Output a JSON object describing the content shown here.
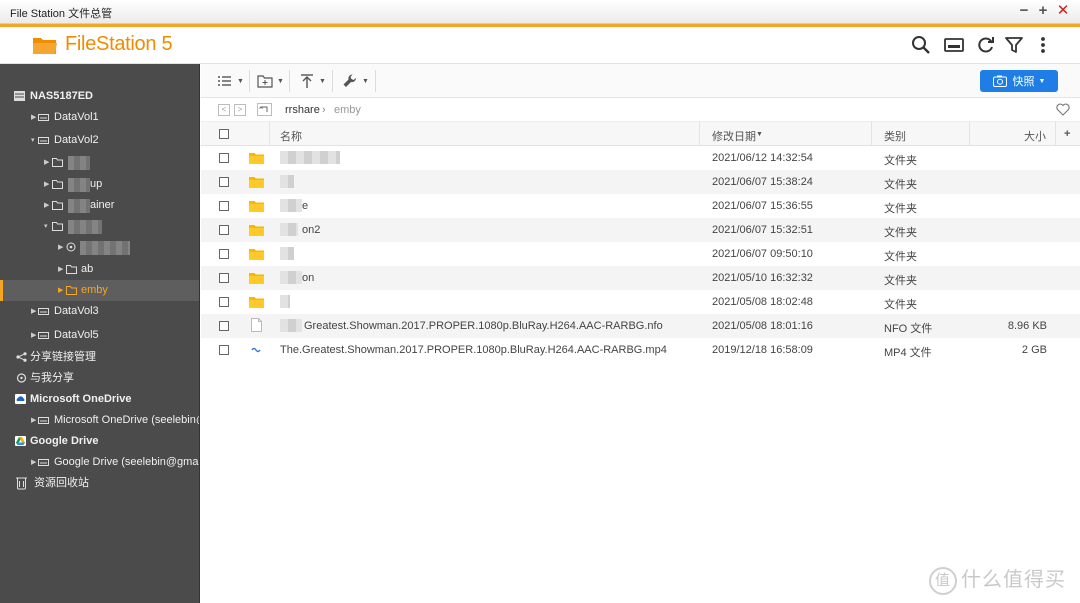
{
  "window": {
    "title": "File Station 文件总管",
    "minimize": "−",
    "maximize": "+",
    "close": "✕"
  },
  "app": {
    "name": "FileStation 5",
    "accent": "#f5a623",
    "primary": "#1e7ee6"
  },
  "header_icons": [
    "search-icon",
    "monitor-icon",
    "refresh-icon",
    "filter-icon",
    "more-vertical-icon"
  ],
  "sidebar": {
    "nas": "NAS5187ED",
    "vol1": "DataVol1",
    "vol2": "DataVol2",
    "vol2_children": [
      "",
      "up",
      "ainer",
      ""
    ],
    "ab": "ab",
    "emby": "emby",
    "vol3": "DataVol3",
    "vol5": "DataVol5",
    "share_links": "分享链接管理",
    "shared_with_me": "与我分享",
    "onedrive": "Microsoft OneDrive",
    "onedrive_account": "Microsoft OneDrive (seelebin@",
    "gdrive": "Google Drive",
    "gdrive_account": "Google Drive (seelebin@gmail",
    "recycle": "资源回收站"
  },
  "toolbar": {
    "snapshot": "快照"
  },
  "breadcrumb": {
    "parent": "rrshare",
    "current": "emby"
  },
  "columns": {
    "name": "名称",
    "modified": "修改日期",
    "type": "类别",
    "size": "大小",
    "add": "+"
  },
  "files": [
    {
      "name": "",
      "date": "2021/06/12 14:32:54",
      "type": "文件夹",
      "size": "",
      "kind": "folder"
    },
    {
      "name": "",
      "date": "2021/06/07 15:38:24",
      "type": "文件夹",
      "size": "",
      "kind": "folder"
    },
    {
      "name": "e",
      "date": "2021/06/07 15:36:55",
      "type": "文件夹",
      "size": "",
      "kind": "folder"
    },
    {
      "name": "on2",
      "date": "2021/06/07 15:32:51",
      "type": "文件夹",
      "size": "",
      "kind": "folder"
    },
    {
      "name": "",
      "date": "2021/06/07 09:50:10",
      "type": "文件夹",
      "size": "",
      "kind": "folder"
    },
    {
      "name": "on",
      "date": "2021/05/10 16:32:32",
      "type": "文件夹",
      "size": "",
      "kind": "folder"
    },
    {
      "name": "",
      "date": "2021/05/08 18:02:48",
      "type": "文件夹",
      "size": "",
      "kind": "folder"
    },
    {
      "name": "Greatest.Showman.2017.PROPER.1080p.BluRay.H264.AAC-RARBG.nfo",
      "date": "2021/05/08 18:01:16",
      "type": "NFO 文件",
      "size": "8.96 KB",
      "kind": "file"
    },
    {
      "name": "The.Greatest.Showman.2017.PROPER.1080p.BluRay.H264.AAC-RARBG.mp4",
      "date": "2019/12/18 16:58:09",
      "type": "MP4 文件",
      "size": "2 GB",
      "kind": "video"
    }
  ],
  "watermark": {
    "glyph": "值",
    "text": "什么值得买"
  }
}
